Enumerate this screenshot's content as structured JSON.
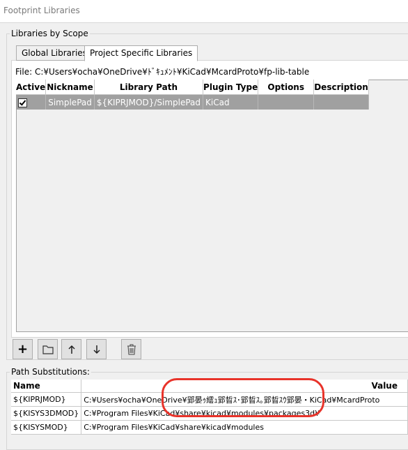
{
  "window": {
    "title": "Footprint Libraries"
  },
  "libraries_group": {
    "label": "Libraries by Scope"
  },
  "tabs": [
    {
      "label": "Global Libraries",
      "active": false
    },
    {
      "label": "Project Specific Libraries",
      "active": true
    }
  ],
  "file": {
    "label": "File:",
    "path": "C:¥Users¥ocha¥OneDrive¥ﾄﾞｷｭﾒﾝﾄ¥KiCad¥McardProto¥fp-lib-table"
  },
  "library_table": {
    "headers": [
      "Active",
      "Nickname",
      "Library Path",
      "Plugin Type",
      "Options",
      "Description"
    ],
    "rows": [
      {
        "active": true,
        "nickname": "SimplePad",
        "path": "${KIPRJMOD}/SimplePad",
        "plugin": "KiCad",
        "options": "",
        "description": ""
      }
    ]
  },
  "toolbar": {
    "add": "+",
    "icons": [
      "plus-icon",
      "folder-icon",
      "arrow-up-icon",
      "arrow-down-icon",
      "trash-icon"
    ]
  },
  "path_group": {
    "label": "Path Substitutions:"
  },
  "path_table": {
    "headers": [
      "Name",
      "Value"
    ],
    "rows": [
      {
        "name": "${KIPRJMOD}",
        "value": "C:¥Users¥ocha¥OneDrive¥郢晏ｩ繧ｭ郢晢ｽ･郢晢ｽ｡郢晢ｽｳ郢晏・KiCad¥McardProto"
      },
      {
        "name": "${KISYS3DMOD}",
        "value": "C:¥Program Files¥KiCad¥share¥kicad¥modules¥packages3d¥"
      },
      {
        "name": "${KISYSMOD}",
        "value": "C:¥Program Files¥KiCad¥share¥kicad¥modules"
      }
    ]
  },
  "colors": {
    "annotation": "#e8332a",
    "selected_row": "#a0a0a0"
  }
}
